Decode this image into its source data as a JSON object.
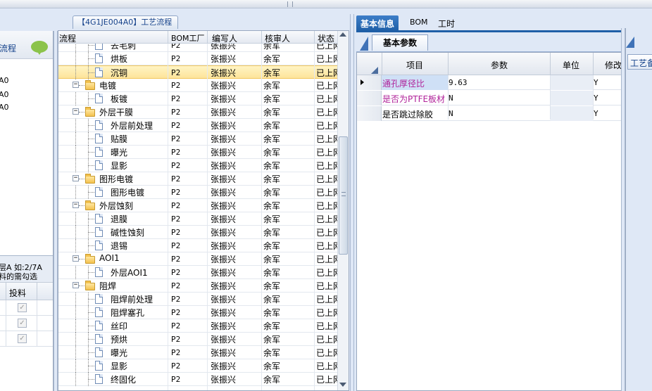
{
  "left_panel": {
    "title": "流程",
    "chat_icon": "speech-bubble-icon",
    "rows": [
      "A0",
      "A0",
      "A0"
    ],
    "note_line1": "层A 如:2/7A",
    "note_line2": "料的需勾选",
    "grid_header": "投料",
    "grid_checks": [
      true,
      true,
      true
    ]
  },
  "middle_panel": {
    "tab_title": "【4G1JE004A0】工艺流程",
    "columns": [
      "流程",
      "BOM工厂",
      "编写人",
      "核审人",
      "状态"
    ],
    "rows": [
      {
        "type": "doc",
        "level": 2,
        "name": "去毛刺",
        "bom": "P2",
        "writer": "张振兴",
        "reviewer": "余军",
        "status": "已上网",
        "selected": false
      },
      {
        "type": "doc",
        "level": 2,
        "name": "烘板",
        "bom": "P2",
        "writer": "张振兴",
        "reviewer": "余军",
        "status": "已上网",
        "selected": false
      },
      {
        "type": "doc",
        "level": 2,
        "name": "沉铜",
        "bom": "P2",
        "writer": "张振兴",
        "reviewer": "余军",
        "status": "已上网",
        "selected": true
      },
      {
        "type": "folder",
        "level": 1,
        "name": "电镀",
        "bom": "P2",
        "writer": "张振兴",
        "reviewer": "余军",
        "status": "已上网",
        "selected": false
      },
      {
        "type": "doc",
        "level": 2,
        "name": "板镀",
        "bom": "P2",
        "writer": "张振兴",
        "reviewer": "余军",
        "status": "已上网",
        "selected": false
      },
      {
        "type": "folder",
        "level": 1,
        "name": "外层干膜",
        "bom": "P2",
        "writer": "张振兴",
        "reviewer": "余军",
        "status": "已上网",
        "selected": false
      },
      {
        "type": "doc",
        "level": 2,
        "name": "外层前处理",
        "bom": "P2",
        "writer": "张振兴",
        "reviewer": "余军",
        "status": "已上网",
        "selected": false
      },
      {
        "type": "doc",
        "level": 2,
        "name": "贴膜",
        "bom": "P2",
        "writer": "张振兴",
        "reviewer": "余军",
        "status": "已上网",
        "selected": false
      },
      {
        "type": "doc",
        "level": 2,
        "name": "曝光",
        "bom": "P2",
        "writer": "张振兴",
        "reviewer": "余军",
        "status": "已上网",
        "selected": false
      },
      {
        "type": "doc",
        "level": 2,
        "name": "显影",
        "bom": "P2",
        "writer": "张振兴",
        "reviewer": "余军",
        "status": "已上网",
        "selected": false
      },
      {
        "type": "folder",
        "level": 1,
        "name": "图形电镀",
        "bom": "P2",
        "writer": "张振兴",
        "reviewer": "余军",
        "status": "已上网",
        "selected": false
      },
      {
        "type": "doc",
        "level": 2,
        "name": "图形电镀",
        "bom": "P2",
        "writer": "张振兴",
        "reviewer": "余军",
        "status": "已上网",
        "selected": false
      },
      {
        "type": "folder",
        "level": 1,
        "name": "外层蚀刻",
        "bom": "P2",
        "writer": "张振兴",
        "reviewer": "余军",
        "status": "已上网",
        "selected": false
      },
      {
        "type": "doc",
        "level": 2,
        "name": "退膜",
        "bom": "P2",
        "writer": "张振兴",
        "reviewer": "余军",
        "status": "已上网",
        "selected": false
      },
      {
        "type": "doc",
        "level": 2,
        "name": "碱性蚀刻",
        "bom": "P2",
        "writer": "张振兴",
        "reviewer": "余军",
        "status": "已上网",
        "selected": false
      },
      {
        "type": "doc",
        "level": 2,
        "name": "退锡",
        "bom": "P2",
        "writer": "张振兴",
        "reviewer": "余军",
        "status": "已上网",
        "selected": false
      },
      {
        "type": "folder",
        "level": 1,
        "name": "AOI1",
        "bom": "P2",
        "writer": "张振兴",
        "reviewer": "余军",
        "status": "已上网",
        "selected": false
      },
      {
        "type": "doc",
        "level": 2,
        "name": "外层AOI1",
        "bom": "P2",
        "writer": "张振兴",
        "reviewer": "余军",
        "status": "已上网",
        "selected": false
      },
      {
        "type": "folder",
        "level": 1,
        "name": "阻焊",
        "bom": "P2",
        "writer": "张振兴",
        "reviewer": "余军",
        "status": "已上网",
        "selected": false
      },
      {
        "type": "doc",
        "level": 2,
        "name": "阻焊前处理",
        "bom": "P2",
        "writer": "张振兴",
        "reviewer": "余军",
        "status": "已上网",
        "selected": false
      },
      {
        "type": "doc",
        "level": 2,
        "name": "阻焊塞孔",
        "bom": "P2",
        "writer": "张振兴",
        "reviewer": "余军",
        "status": "已上网",
        "selected": false
      },
      {
        "type": "doc",
        "level": 2,
        "name": "丝印",
        "bom": "P2",
        "writer": "张振兴",
        "reviewer": "余军",
        "status": "已上网",
        "selected": false
      },
      {
        "type": "doc",
        "level": 2,
        "name": "预烘",
        "bom": "P2",
        "writer": "张振兴",
        "reviewer": "余军",
        "status": "已上网",
        "selected": false
      },
      {
        "type": "doc",
        "level": 2,
        "name": "曝光",
        "bom": "P2",
        "writer": "张振兴",
        "reviewer": "余军",
        "status": "已上网",
        "selected": false
      },
      {
        "type": "doc",
        "level": 2,
        "name": "显影",
        "bom": "P2",
        "writer": "张振兴",
        "reviewer": "余军",
        "status": "已上网",
        "selected": false
      },
      {
        "type": "doc",
        "level": 2,
        "name": "终固化",
        "bom": "P2",
        "writer": "张振兴",
        "reviewer": "余军",
        "status": "已上网",
        "selected": false
      }
    ]
  },
  "right_panel": {
    "tabs": [
      "基本信息",
      "BOM",
      "工时"
    ],
    "active_tab": "基本信息",
    "sub_tab": "基本参数",
    "columns": [
      "项目",
      "参数",
      "单位",
      "修改"
    ],
    "rows": [
      {
        "item": "通孔厚径比",
        "value": "9.63",
        "unit": "",
        "modified": "Y",
        "highlight": true,
        "item_color": "#b0229a",
        "pointer": true
      },
      {
        "item": "是否为PTFE板材",
        "value": "N",
        "unit": "",
        "modified": "Y",
        "highlight": false,
        "item_color": "#b0229a",
        "pointer": false
      },
      {
        "item": "是否跳过除胶",
        "value": "N",
        "unit": "",
        "modified": "Y",
        "highlight": false,
        "item_color": "#000000",
        "pointer": false
      }
    ]
  },
  "far_right": {
    "tab_label": "工艺备"
  },
  "colors": {
    "accent": "#1f5fa7",
    "selected_row": "#fde49a",
    "panel_bg": "#dfe8f6"
  }
}
